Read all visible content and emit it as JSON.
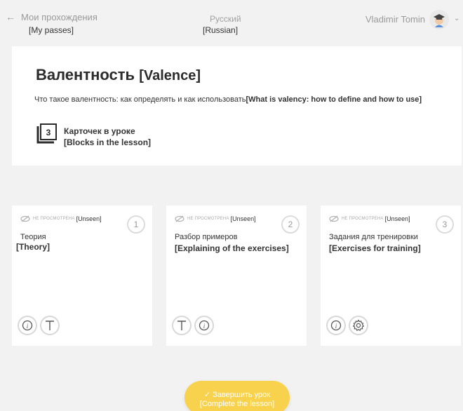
{
  "header": {
    "back_label": "Мои прохождения",
    "back_label_tr": "[My passes]",
    "language": "Русский",
    "language_tr": "[Russian]",
    "user_name": "Vladimir Tomin"
  },
  "lesson": {
    "title": "Валентность",
    "title_tr": "[Valence]",
    "subtitle": "Что такое валентность: как определять и как использовать",
    "subtitle_tr": "[What is valency: how to define and how to use]",
    "block_count": "3",
    "blocks_label": "Карточек в уроке",
    "blocks_label_tr": "[Blocks in the lesson]"
  },
  "cards": [
    {
      "status": "НЕ ПРОСМОТРЕНА",
      "status_tr": "[Unseen]",
      "number": "1",
      "name": "Теория",
      "name_tr": "[Theory]",
      "icons": [
        "info-icon",
        "text-icon"
      ]
    },
    {
      "status": "НЕ ПРОСМОТРЕНА",
      "status_tr": "[Unseen]",
      "number": "2",
      "name": "Разбор примеров",
      "name_tr": "[Explaining of the exercises]",
      "icons": [
        "text-icon",
        "info-icon"
      ]
    },
    {
      "status": "НЕ ПРОСМОТРЕНА",
      "status_tr": "[Unseen]",
      "number": "3",
      "name": "Задания для тренировки",
      "name_tr": "[Exercises for training]",
      "icons": [
        "info-icon",
        "gear-icon"
      ]
    }
  ],
  "finish": {
    "label": "✓ Завершить урок",
    "label_tr": "[Complete the lesson]"
  },
  "colors": {
    "background": "#f2f2f2",
    "accent": "#f8d24d",
    "muted_text": "#9a9a9a"
  }
}
